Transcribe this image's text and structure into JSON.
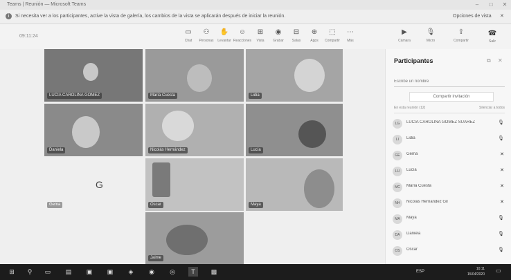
{
  "window": {
    "title": "Teams | Reunión — Microsoft Teams",
    "min": "–",
    "max": "□",
    "close": "✕"
  },
  "infobar": {
    "message": "Si necesita ver a los participantes, active la vista de galería, los cambios de la vista se aplicarán después de iniciar la reunión.",
    "option": "Opciones de vista",
    "close": "✕"
  },
  "toolbar": {
    "time": "09:11:24",
    "tools": [
      {
        "label": "Chat",
        "icon": "▭"
      },
      {
        "label": "Personas",
        "icon": "⚇"
      },
      {
        "label": "Levantar",
        "icon": "✋"
      },
      {
        "label": "Reacciones",
        "icon": "☺"
      },
      {
        "label": "Vista",
        "icon": "⊞"
      },
      {
        "label": "Grabar",
        "icon": "◉"
      },
      {
        "label": "Salas",
        "icon": "⊟"
      },
      {
        "label": "Apps",
        "icon": "⊕"
      },
      {
        "label": "Compartir",
        "icon": "⬚"
      },
      {
        "label": "Más",
        "icon": "⋯"
      },
      {
        "label": "Cámara",
        "icon": "▶"
      },
      {
        "label": "Micro",
        "icon": "🎙"
      },
      {
        "label": "Compartir",
        "icon": "⇪"
      }
    ],
    "leave": {
      "label": "Salir",
      "icon": "☎"
    }
  },
  "tiles": [
    {
      "name": "LUCIA CAROLINA GOMEZ"
    },
    {
      "name": "María Cuesta"
    },
    {
      "name": "Lidia"
    },
    {
      "name": "Daniela"
    },
    {
      "name": "Nicolás Hernández"
    },
    {
      "name": "Lucía"
    },
    {
      "name": "Gema"
    },
    {
      "name": "Oscar"
    },
    {
      "name": "Maya"
    },
    {
      "name": "Jaime"
    }
  ],
  "avatar_letter": "G",
  "participants": {
    "title": "Participantes",
    "search_placeholder": "Escribe un nombre",
    "share_label": "Compartir invitación",
    "section_label": "En esta reunión (12)",
    "section_action": "Silenciar a todos",
    "people": [
      {
        "initials": "LG",
        "name": "LUCIA CAROLINA GOMEZ SUAREZ"
      },
      {
        "initials": "LI",
        "name": "Lidia"
      },
      {
        "initials": "GE",
        "name": "Gema"
      },
      {
        "initials": "LU",
        "name": "Lucía"
      },
      {
        "initials": "MC",
        "name": "María Cuesta"
      },
      {
        "initials": "NH",
        "name": "Nicolás Hernández Gil"
      },
      {
        "initials": "MA",
        "name": "Maya"
      },
      {
        "initials": "DA",
        "name": "Daniela"
      },
      {
        "initials": "OS",
        "name": "Oscar"
      }
    ]
  },
  "taskbar": {
    "time": "10:11",
    "date": "15/04/2020",
    "lang": "ESP"
  }
}
